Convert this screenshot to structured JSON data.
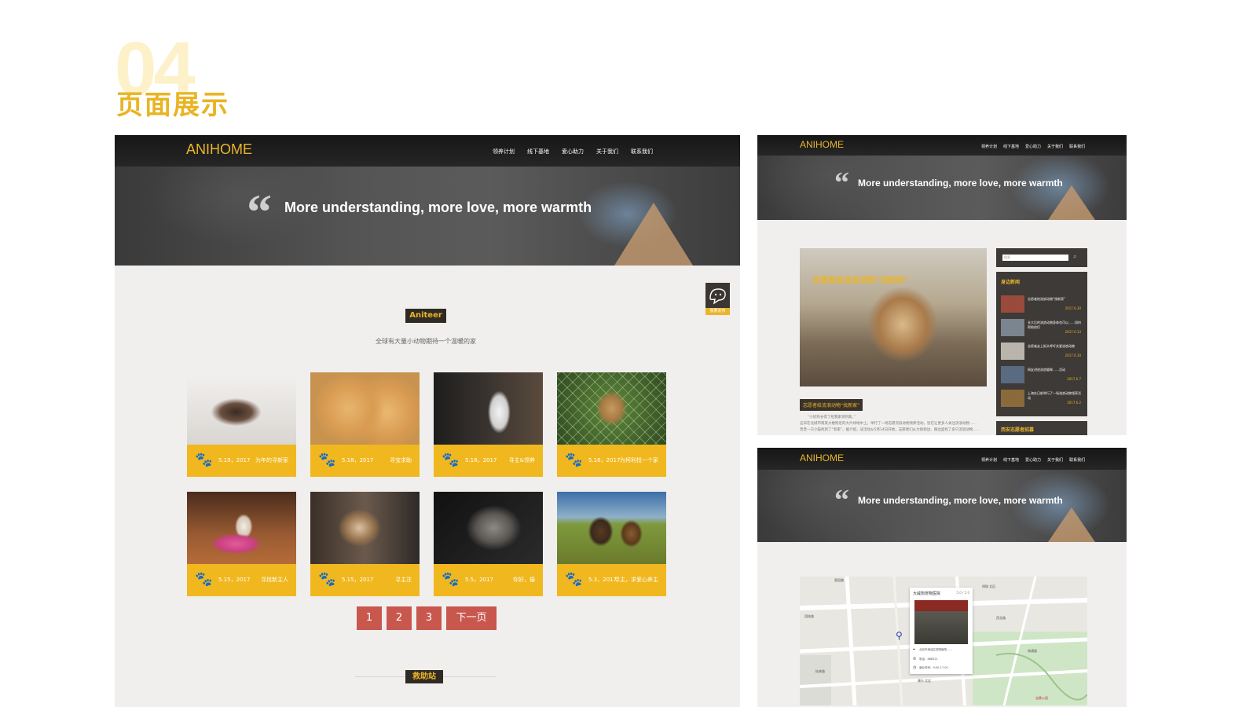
{
  "section": {
    "number": "04",
    "title": "页面展示"
  },
  "site": {
    "brand": "ANIHOME",
    "menu": [
      "领养计划",
      "线下基地",
      "爱心助力",
      "关于我们",
      "联系我们"
    ],
    "hero_quote": "More understanding, more love, more warmth"
  },
  "main_panel": {
    "tag": "Aniteer",
    "subtitle": "全球有大量小动物期待一个温暖的家",
    "float_button": "我要发布",
    "cards": [
      {
        "date": "5.19，2017",
        "caption": "为年的寻新家"
      },
      {
        "date": "5.18，2017",
        "caption": "寻宝求助"
      },
      {
        "date": "5.18，2017",
        "caption": "寻主&领养"
      },
      {
        "date": "5.16，2017",
        "caption": "为柯利找一个家"
      },
      {
        "date": "5.15，2017",
        "caption": "寻找新主人"
      },
      {
        "date": "5.15，2017",
        "caption": "寻主注"
      },
      {
        "date": "5.5，2017",
        "caption": "你好，猫"
      },
      {
        "date": "5.3，2017",
        "caption": "寻主，求爱心养主"
      }
    ],
    "pagination": [
      "1",
      "2",
      "3",
      "下一页"
    ],
    "bottom_tag": "救助站"
  },
  "news_panel": {
    "feature_caption": "志愿者给流浪动物“找新家”",
    "article_tag": "志愿者给流浪动物“找新家”",
    "article_text_1": "“小奶狗长得了给我家领到家。”",
    "article_text_2": "这日在北城市南某大楼附近的大片绿地中上，举行了一场志愿流浪动物领养活动，旨在让更多人关注流浪动物……",
    "article_text_3": "普普一只小猫找到了“新家”。据介绍，该活动从5月14日开始，志愿者们从大街街边、路边里找了多只流浪动物……",
    "search_placeholder": "搜索",
    "sidebar_title": "身边新闻",
    "sidebar_title_2": "西安志愿者招募",
    "news": [
      {
        "text": "志愿者给流浪动物“找新家”",
        "date": "2017.6.30"
      },
      {
        "text": "长大后的流浪动物身体也可以……如何帮助他们",
        "date": "2017.6.13"
      },
      {
        "text": "志愿者走上街头呼吁关爱流浪动物",
        "date": "2017.6.10"
      },
      {
        "text": "网友讲述流浪猫咪……活动",
        "date": "2017.6.7"
      },
      {
        "text": "上海在日前举行了一场流浪动物领养活动",
        "date": "2017.6.2"
      }
    ]
  },
  "map_panel": {
    "popup_title": "大威狗宠物医院",
    "popup_rating": "5.0 / 5.0",
    "popup_address": "北京市海淀区宠物医院……",
    "popup_phone": "电话：888321",
    "popup_hours": "营业时间：9:00-17:00",
    "labels": [
      "奥园路",
      "团结路",
      "康乐 北区",
      "明珠 北区",
      "南通路",
      "宝鼎公园",
      "桂林路",
      "西北路"
    ]
  },
  "colors": {
    "accent": "#eab52b",
    "pager": "#c8574e",
    "dark": "#1d1d1d",
    "panel_bg": "#f1efed"
  }
}
